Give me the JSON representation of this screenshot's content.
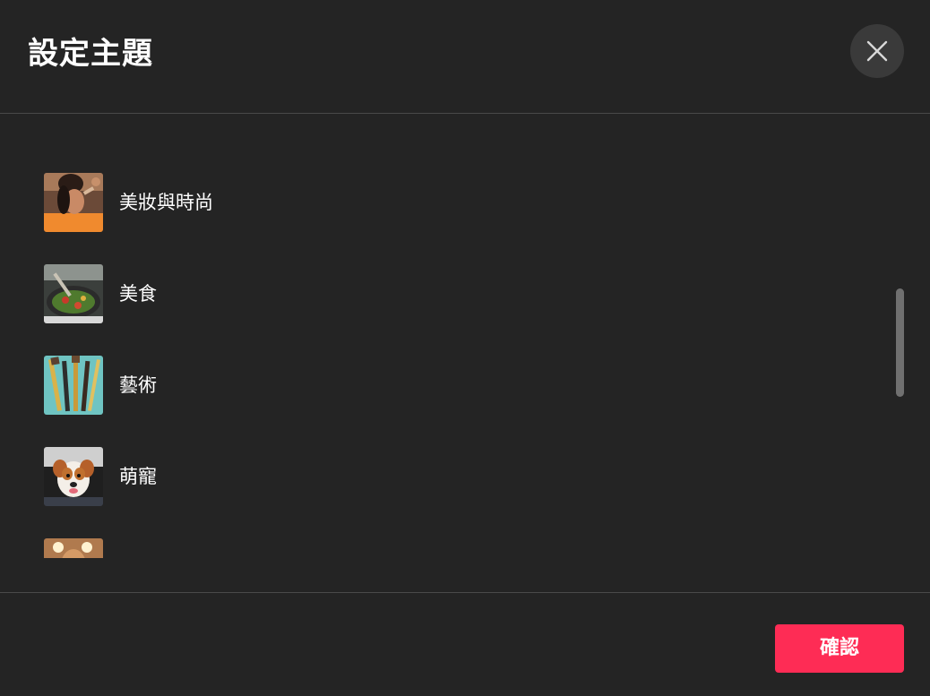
{
  "dialog": {
    "title": "設定主題",
    "close_icon": "close-icon",
    "confirm_label": "確認"
  },
  "topics": [
    {
      "label": "美妝與時尚",
      "thumbnail": "beauty-fashion-photo"
    },
    {
      "label": "美食",
      "thumbnail": "food-photo"
    },
    {
      "label": "藝術",
      "thumbnail": "art-brushes-photo"
    },
    {
      "label": "萌寵",
      "thumbnail": "pet-dog-photo"
    },
    {
      "label": "",
      "thumbnail": "partially-visible-photo"
    }
  ],
  "colors": {
    "background": "#242424",
    "divider": "#4a4a4a",
    "accent": "#fe2c55",
    "close_button_bg": "#3a3a3a",
    "scrollbar": "#707070"
  }
}
